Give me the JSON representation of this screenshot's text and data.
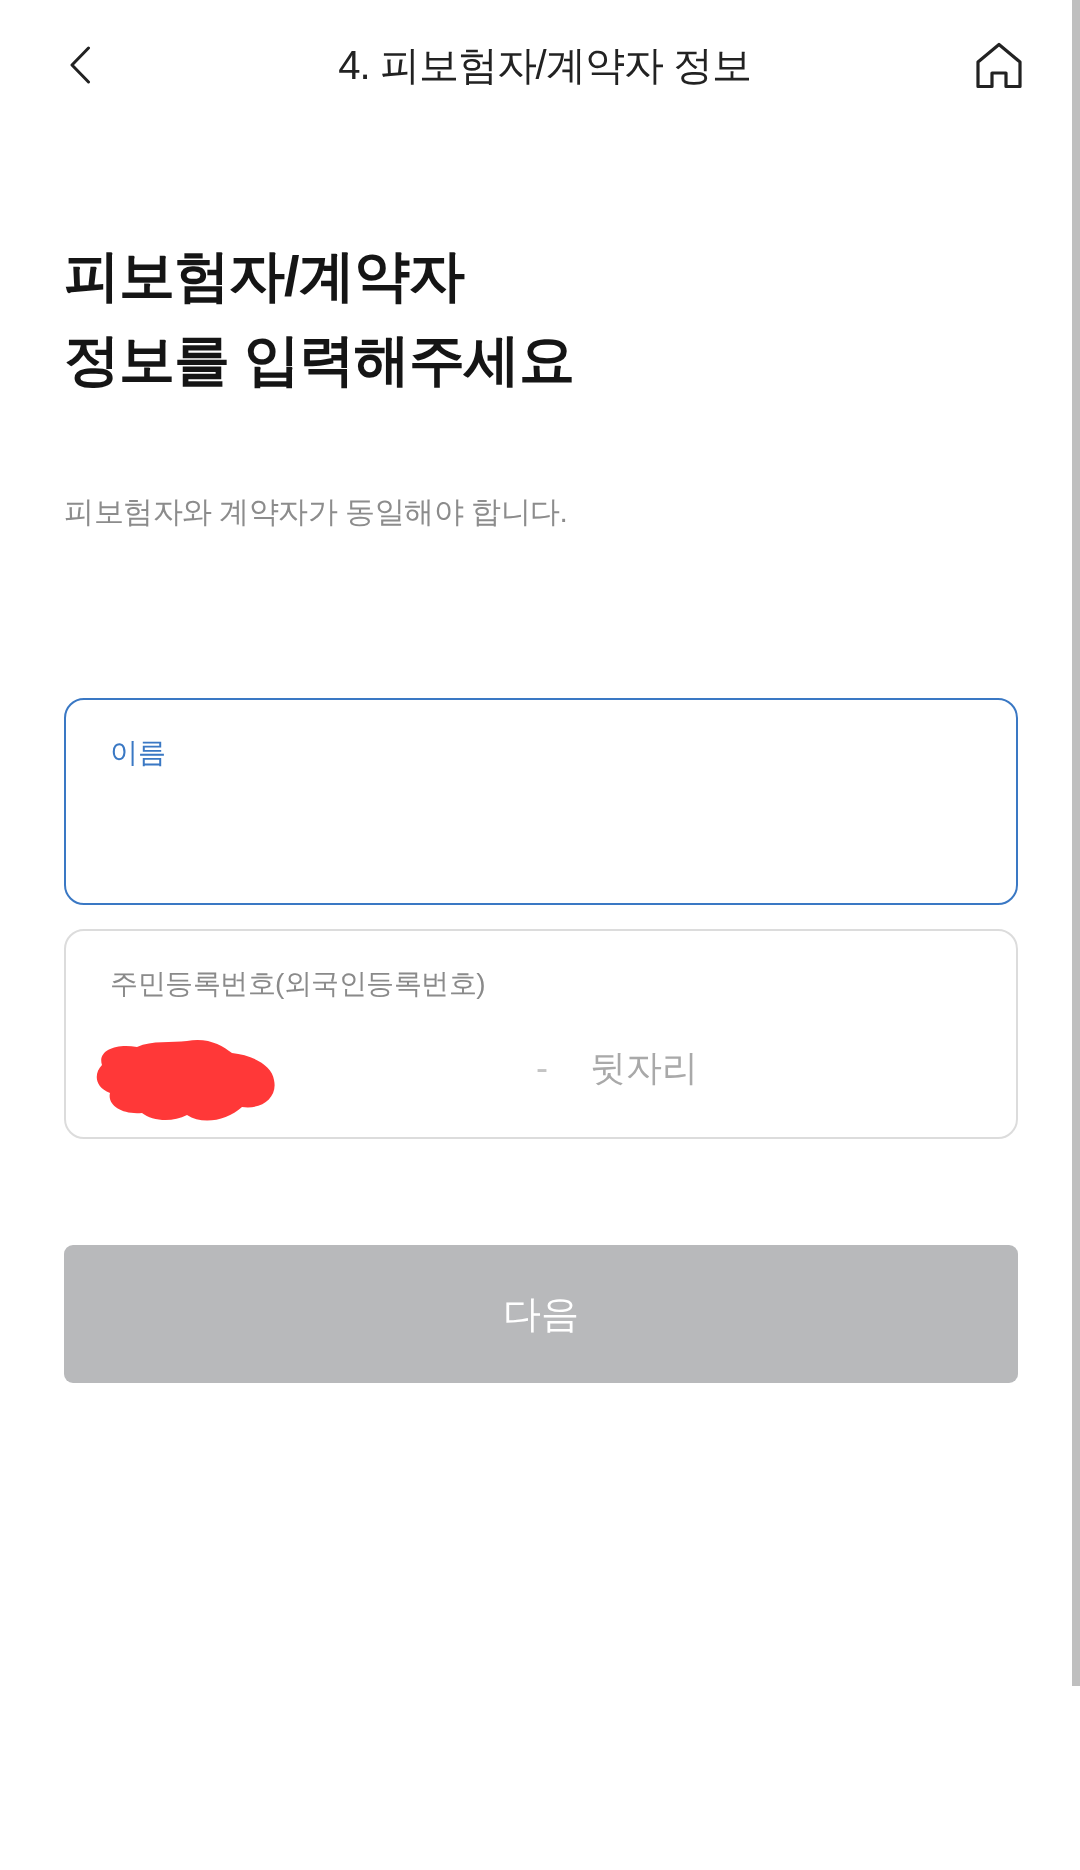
{
  "header": {
    "title": "4. 피보험자/계약자 정보"
  },
  "heading": {
    "lines": [
      "피보험자/계약자",
      "정보를 입력해주세요"
    ]
  },
  "note": "피보험자와 계약자가 동일해야 합니다.",
  "fields": [
    {
      "kind": "text",
      "label": "이름",
      "focused": true
    },
    {
      "kind": "resident_number",
      "label": "주민등록번호(외국인등록번호)",
      "focused": false,
      "front_redacted": true,
      "separator": "-",
      "back_placeholder": "뒷자리"
    }
  ],
  "next_button": {
    "label": "다음",
    "disabled": true
  }
}
